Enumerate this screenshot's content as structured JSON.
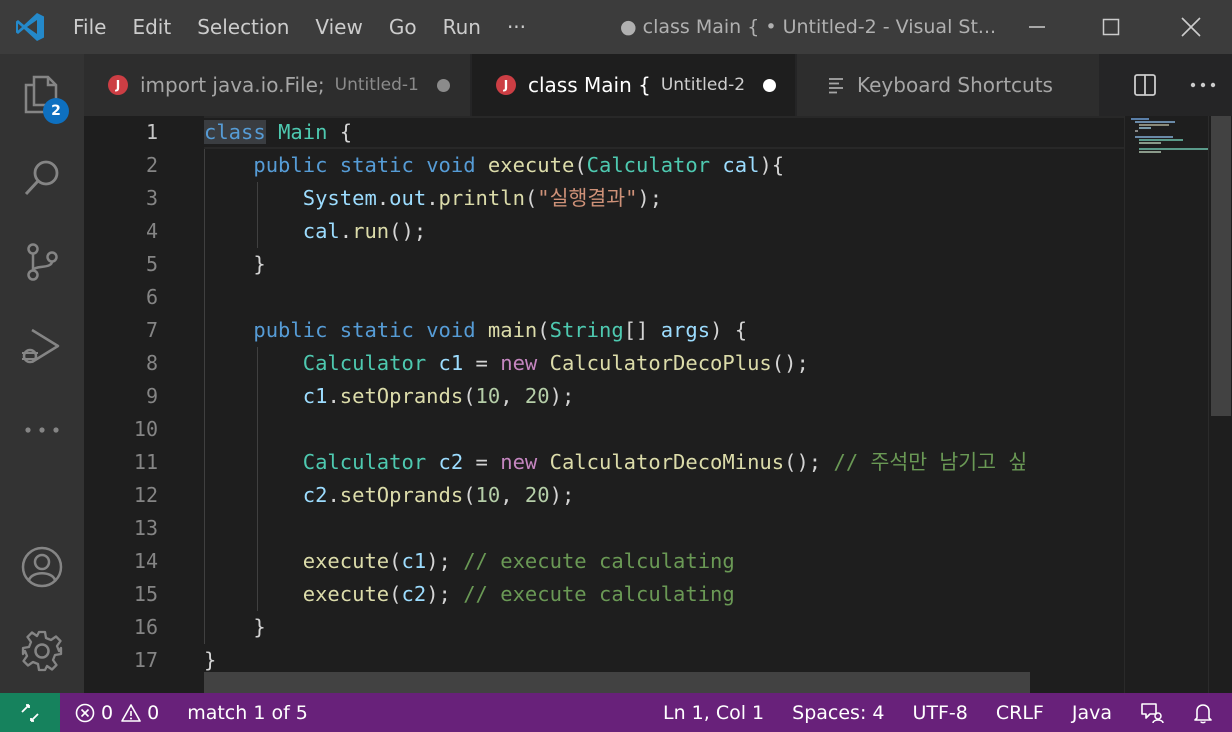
{
  "titlebar": {
    "menu": [
      "File",
      "Edit",
      "Selection",
      "View",
      "Go",
      "Run",
      "···"
    ],
    "window_title": "● class Main { • Untitled-2 - Visual St..."
  },
  "activity": {
    "explorer_badge": "2"
  },
  "tabs": [
    {
      "title": "import java.io.File;",
      "desc": "Untitled-1",
      "icon": "J",
      "active": false,
      "dirty": true
    },
    {
      "title": "class Main {",
      "desc": "Untitled-2",
      "icon": "J",
      "active": true,
      "dirty": true
    },
    {
      "title": "Keyboard Shortcuts",
      "desc": "",
      "icon": "keyboard-shortcuts-icon",
      "active": false,
      "dirty": false
    }
  ],
  "editor": {
    "line_numbers": [
      "1",
      "2",
      "3",
      "4",
      "5",
      "6",
      "7",
      "8",
      "9",
      "10",
      "11",
      "12",
      "13",
      "14",
      "15",
      "16",
      "17"
    ],
    "current_line": 1
  },
  "statusbar": {
    "errors": "0",
    "warnings": "0",
    "search": "match 1 of 5",
    "position": "Ln 1, Col 1",
    "spaces": "Spaces: 4",
    "encoding": "UTF-8",
    "eol": "CRLF",
    "language": "Java"
  },
  "colors": {
    "statusbar": "#68217a",
    "remote": "#16825d",
    "badge": "#0e70c0",
    "java_icon": "#cc3e44"
  }
}
